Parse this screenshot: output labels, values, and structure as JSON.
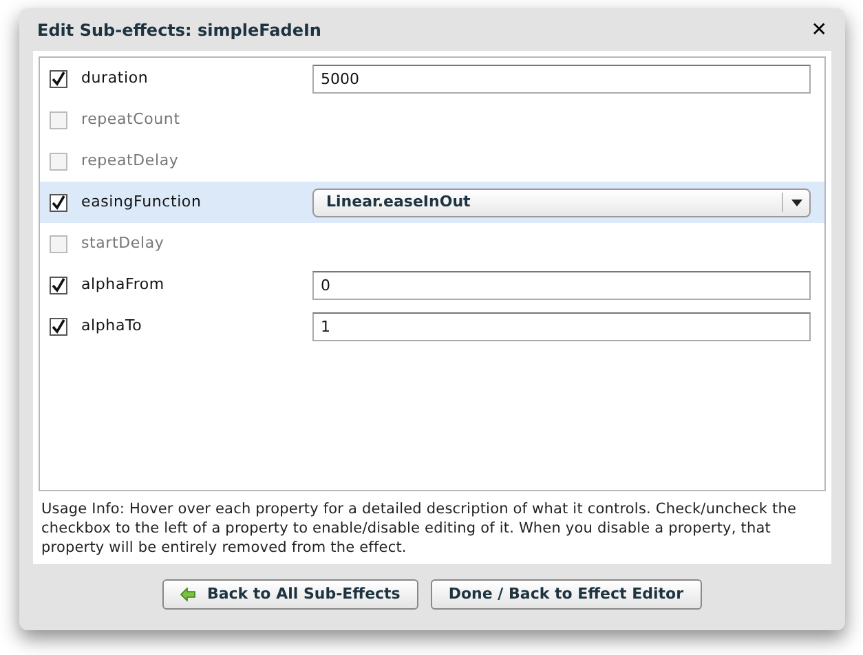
{
  "dialog": {
    "title": "Edit Sub-effects: simpleFadeIn",
    "close": "✕"
  },
  "properties": [
    {
      "label": "duration",
      "checked": true,
      "selected": false,
      "kind": "text",
      "value": "5000"
    },
    {
      "label": "repeatCount",
      "checked": false,
      "selected": false,
      "kind": "none"
    },
    {
      "label": "repeatDelay",
      "checked": false,
      "selected": false,
      "kind": "none"
    },
    {
      "label": "easingFunction",
      "checked": true,
      "selected": true,
      "kind": "select",
      "value": "Linear.easeInOut"
    },
    {
      "label": "startDelay",
      "checked": false,
      "selected": false,
      "kind": "none"
    },
    {
      "label": "alphaFrom",
      "checked": true,
      "selected": false,
      "kind": "text",
      "value": "0"
    },
    {
      "label": "alphaTo",
      "checked": true,
      "selected": false,
      "kind": "text",
      "value": "1"
    }
  ],
  "usage_info": "Usage Info: Hover over each property for a detailed description of what it controls.  Check/uncheck the checkbox to the left of a property to enable/disable editing of it.  When you disable a property, that property will be entirely removed from the effect.",
  "buttons": [
    {
      "label": "Back to All Sub-Effects",
      "kind": "back"
    },
    {
      "label": "Done / Back to Effect Editor",
      "kind": "plain"
    }
  ]
}
